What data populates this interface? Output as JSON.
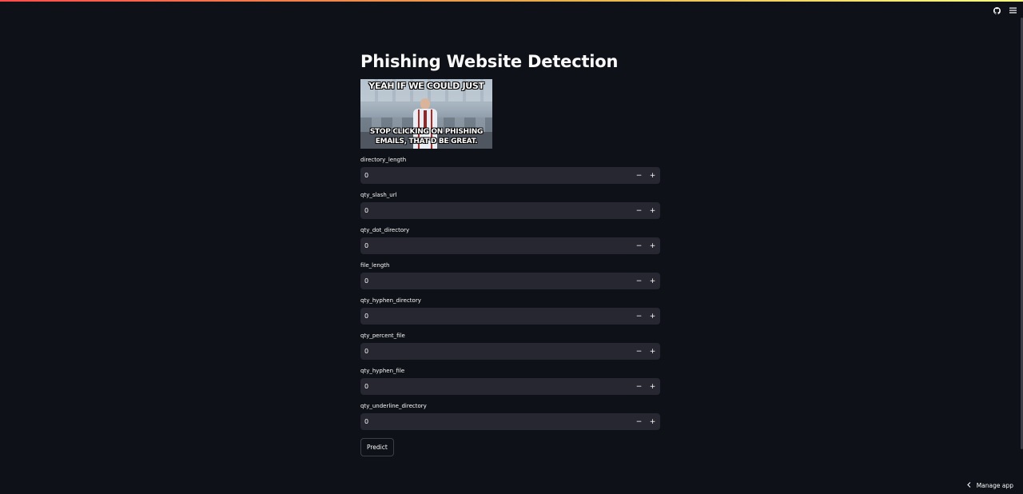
{
  "header": {
    "icons": [
      "github-icon",
      "hamburger-menu-icon"
    ]
  },
  "main": {
    "title": "Phishing Website Detection",
    "meme": {
      "top_text": "YEAH IF WE COULD JUST",
      "bottom_text_line1": "STOP CLICKING ON PHISHING",
      "bottom_text_line2": "EMAILS, THAT'D BE GREAT."
    },
    "fields": [
      {
        "label": "directory_length",
        "value": "0"
      },
      {
        "label": "qty_slash_url",
        "value": "0"
      },
      {
        "label": "qty_dot_directory",
        "value": "0"
      },
      {
        "label": "file_length",
        "value": "0"
      },
      {
        "label": "qty_hyphen_directory",
        "value": "0"
      },
      {
        "label": "qty_percent_file",
        "value": "0"
      },
      {
        "label": "qty_hyphen_file",
        "value": "0"
      },
      {
        "label": "qty_underline_directory",
        "value": "0"
      }
    ],
    "stepper_minus": "−",
    "stepper_plus": "+",
    "predict_label": "Predict"
  },
  "footer": {
    "manage_app_label": "Manage app",
    "manage_app_icon": "chevron-left-icon"
  },
  "colors": {
    "background": "#0e1117",
    "input_background": "#262730",
    "text": "#fafafa",
    "accent_gradient_start": "#ff4b4b",
    "accent_gradient_end": "#fffd80"
  }
}
